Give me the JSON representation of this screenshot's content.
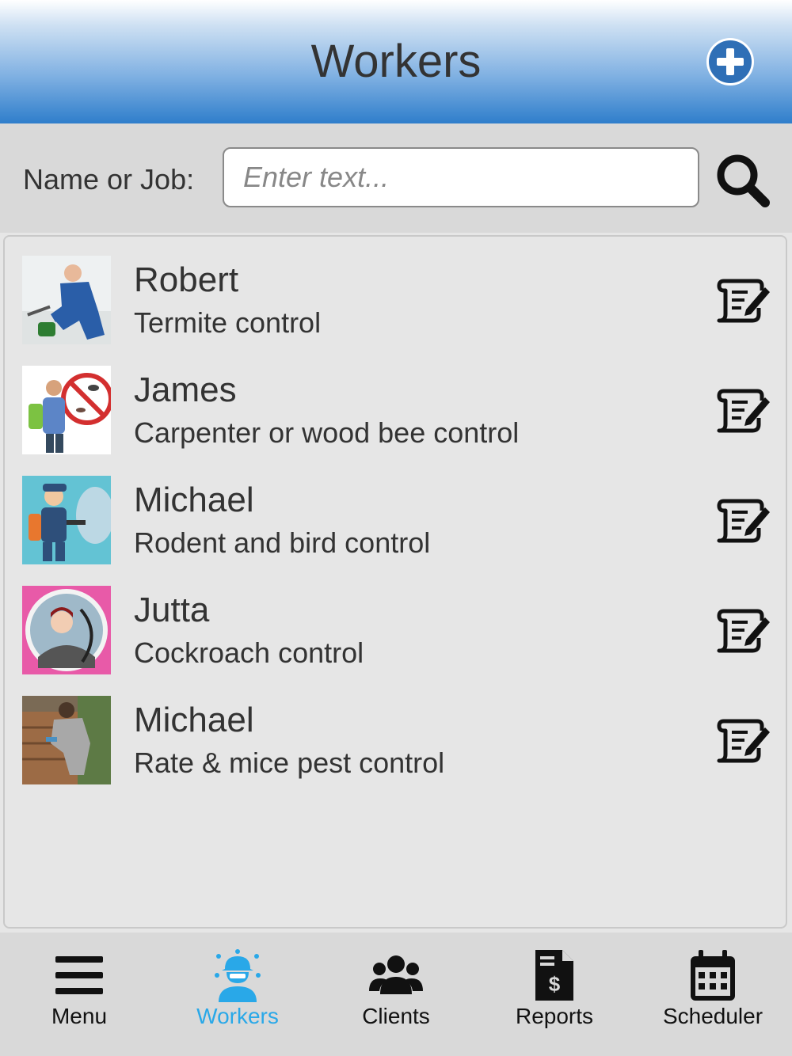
{
  "header": {
    "title": "Workers"
  },
  "search": {
    "label": "Name or Job:",
    "placeholder": "Enter text..."
  },
  "workers": [
    {
      "name": "Robert",
      "job": "Termite control"
    },
    {
      "name": "James",
      "job": "Carpenter or wood bee control"
    },
    {
      "name": "Michael",
      "job": "Rodent and bird control"
    },
    {
      "name": "Jutta",
      "job": "Cockroach control"
    },
    {
      "name": "Michael",
      "job": "Rate & mice pest control"
    }
  ],
  "tabbar": {
    "items": [
      {
        "label": "Menu",
        "icon": "hamburger-icon"
      },
      {
        "label": "Workers",
        "icon": "worker-icon",
        "active": true
      },
      {
        "label": "Clients",
        "icon": "group-icon"
      },
      {
        "label": "Reports",
        "icon": "invoice-icon"
      },
      {
        "label": "Scheduler",
        "icon": "calendar-icon"
      }
    ]
  },
  "colors": {
    "accent": "#29a8e8",
    "header_bottom": "#2f7ecb",
    "background": "#e6e6e6"
  }
}
